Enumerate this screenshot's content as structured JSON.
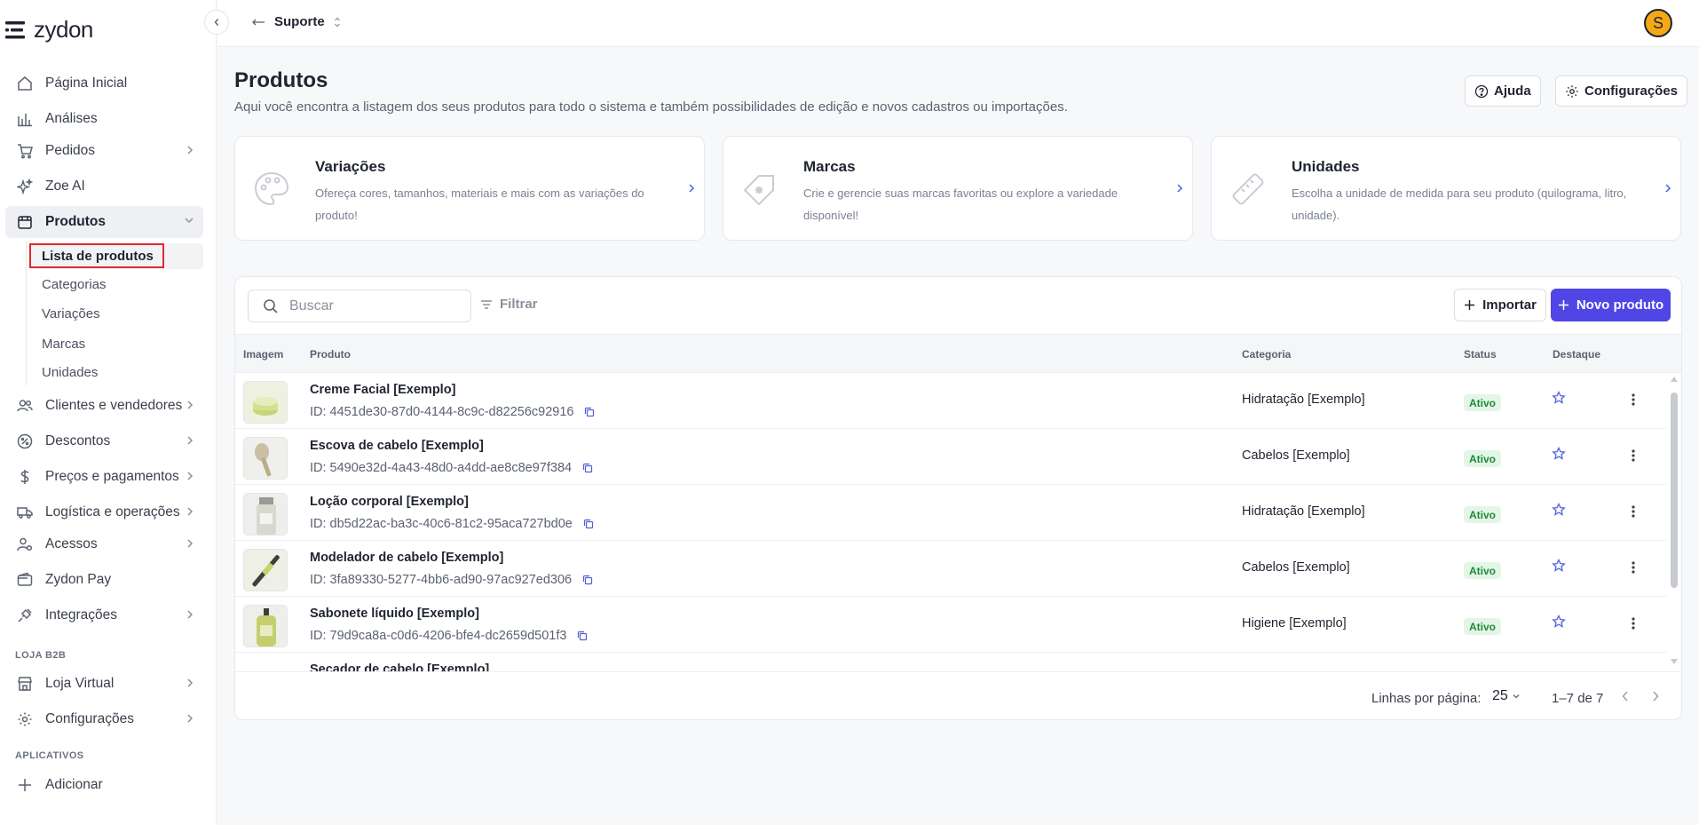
{
  "app": {
    "logo_text": "zydon"
  },
  "sidebar": {
    "items": [
      {
        "label": "Página Inicial"
      },
      {
        "label": "Análises"
      },
      {
        "label": "Pedidos"
      },
      {
        "label": "Zoe AI"
      },
      {
        "label": "Produtos"
      },
      {
        "label": "Clientes e vendedores"
      },
      {
        "label": "Descontos"
      },
      {
        "label": "Preços e pagamentos"
      },
      {
        "label": "Logística e operações"
      },
      {
        "label": "Acessos"
      },
      {
        "label": "Zydon Pay"
      },
      {
        "label": "Integrações"
      },
      {
        "label": "Loja Virtual"
      },
      {
        "label": "Configurações"
      },
      {
        "label": "Adicionar"
      }
    ],
    "products_sub": [
      "Lista de produtos",
      "Categorias",
      "Variações",
      "Marcas",
      "Unidades"
    ],
    "section_b2b": "LOJA B2B",
    "section_apps": "APLICATIVOS"
  },
  "topbar": {
    "breadcrumb": "Suporte",
    "avatar_initial": "S"
  },
  "header": {
    "title": "Produtos",
    "description": "Aqui você encontra a listagem dos seus produtos para todo o sistema e também possibilidades de edição e novos cadastros ou importações.",
    "help_label": "Ajuda",
    "settings_label": "Configurações"
  },
  "cards": [
    {
      "title": "Variações",
      "description": "Ofereça cores, tamanhos, materiais e mais com as variações do produto!"
    },
    {
      "title": "Marcas",
      "description": "Crie e gerencie suas marcas favoritas ou explore a variedade disponível!"
    },
    {
      "title": "Unidades",
      "description": "Escolha a unidade de medida para seu produto (quilograma, litro, unidade)."
    }
  ],
  "toolbar": {
    "search_placeholder": "Buscar",
    "filter_label": "Filtrar",
    "import_label": "Importar",
    "new_label": "Novo produto"
  },
  "table": {
    "columns": [
      "Imagem",
      "Produto",
      "Categoria",
      "Status",
      "Destaque"
    ],
    "rows": [
      {
        "name": "Creme Facial [Exemplo]",
        "id": "ID: 4451de30-87d0-4144-8c9c-d82256c92916",
        "category": "Hidratação [Exemplo]",
        "status": "Ativo"
      },
      {
        "name": "Escova de cabelo [Exemplo]",
        "id": "ID: 5490e32d-4a43-48d0-a4dd-ae8c8e97f384",
        "category": "Cabelos [Exemplo]",
        "status": "Ativo"
      },
      {
        "name": "Loção corporal [Exemplo]",
        "id": "ID: db5d22ac-ba3c-40c6-81c2-95aca727bd0e",
        "category": "Hidratação [Exemplo]",
        "status": "Ativo"
      },
      {
        "name": "Modelador de cabelo [Exemplo]",
        "id": "ID: 3fa89330-5277-4bb6-ad90-97ac927ed306",
        "category": "Cabelos [Exemplo]",
        "status": "Ativo"
      },
      {
        "name": "Sabonete líquido [Exemplo]",
        "id": "ID: 79d9ca8a-c0d6-4206-bfe4-dc2659d501f3",
        "category": "Higiene [Exemplo]",
        "status": "Ativo"
      },
      {
        "name": "Secador de cabelo [Exemplo]",
        "id": "",
        "category": "",
        "status": ""
      }
    ]
  },
  "pagination": {
    "rows_per_page_label": "Linhas por página:",
    "rows_per_page": "25",
    "range": "1–7 de 7"
  },
  "colors": {
    "primary": "#4f46e5",
    "active_badge_bg": "#e3f6e6",
    "active_badge_text": "#1f8a3c",
    "avatar": "#f5a814",
    "highlight": "#e12b2b"
  }
}
